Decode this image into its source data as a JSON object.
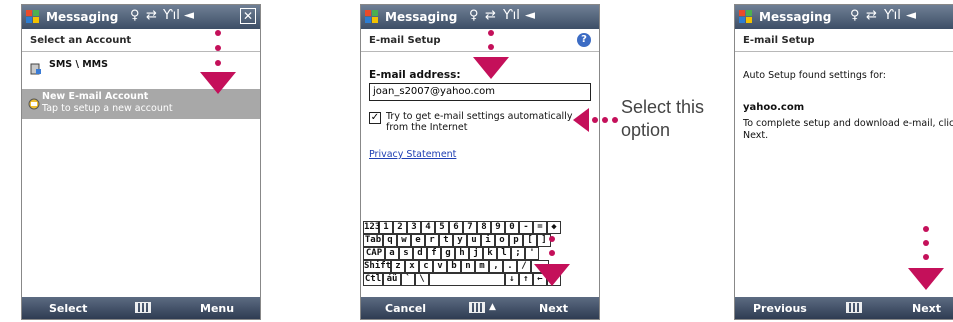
{
  "app_title": "Messaging",
  "screen1": {
    "header": "Select an Account",
    "items": [
      {
        "label": "SMS \\ MMS"
      },
      {
        "label": "New E-mail Account",
        "sub": "Tap to setup a new account"
      }
    ],
    "soft_left": "Select",
    "soft_right": "Menu"
  },
  "screen2": {
    "header": "E-mail Setup",
    "email_label": "E-mail address:",
    "email_value": "joan_s2007@yahoo.com",
    "checkbox_label_line1": "Try to get e-mail settings automatically",
    "checkbox_label_line2": "from the Internet",
    "privacy_link": "Privacy Statement",
    "keyboard_rows": [
      [
        "123",
        "1",
        "2",
        "3",
        "4",
        "5",
        "6",
        "7",
        "8",
        "9",
        "0",
        "-",
        "=",
        "◆"
      ],
      [
        "Tab",
        "q",
        "w",
        "e",
        "r",
        "t",
        "y",
        "u",
        "i",
        "o",
        "p",
        "[",
        "]"
      ],
      [
        "CAP",
        "a",
        "s",
        "d",
        "f",
        "g",
        "h",
        "j",
        "k",
        "l",
        ";",
        "'"
      ],
      [
        "Shift",
        "z",
        "x",
        "c",
        "v",
        "b",
        "n",
        "m",
        ",",
        ".",
        "/",
        "↵"
      ],
      [
        "Ctl",
        "áü",
        "`",
        "\\",
        "",
        "",
        "↓",
        "↑",
        "←",
        "→"
      ]
    ],
    "soft_left": "Cancel",
    "soft_right": "Next"
  },
  "screen3": {
    "header": "E-mail Setup",
    "found_text": "Auto Setup found settings for:",
    "domain": "yahoo.com",
    "instruction_line1": "To complete setup and download e-mail, click",
    "instruction_line2": "Next.",
    "soft_left": "Previous",
    "soft_right": "Next"
  },
  "callout": {
    "line1": "Select this",
    "line2": "option"
  },
  "colors": {
    "accent": "#c4105a",
    "titlebar": "#3d4e66",
    "highlight": "#a8a8a8"
  }
}
